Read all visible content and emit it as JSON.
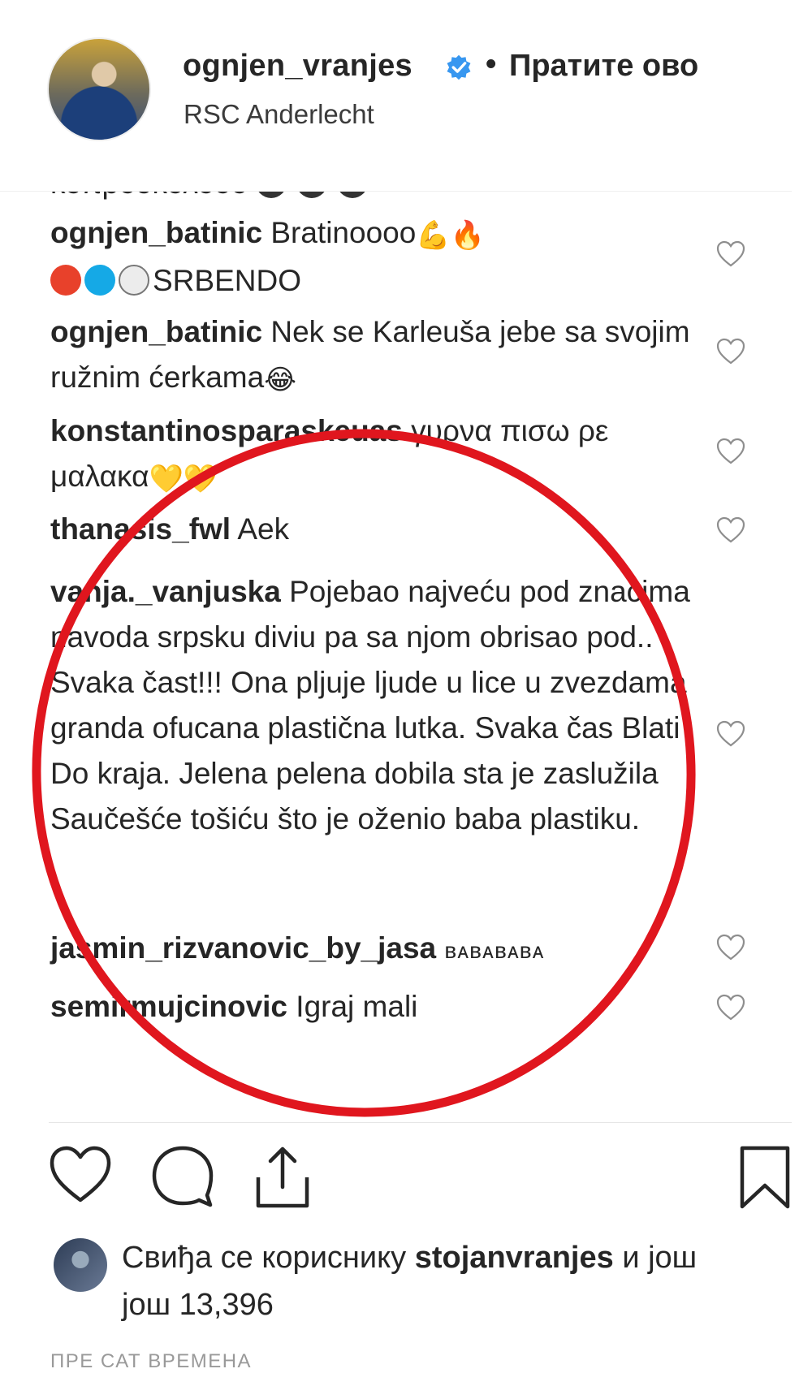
{
  "header": {
    "username": "ognjen_vranjes",
    "separator": "•",
    "follow_label": "Пратите ово",
    "location": "RSC Anderlecht"
  },
  "comments": {
    "cut_off_text": "κοπρουκολοοο",
    "items": [
      {
        "user": "ognjen_batinic",
        "text": "Bratinoooo",
        "line2_text": "SRBENDO"
      },
      {
        "user": "ognjen_batinic",
        "text": "Nek se Karleuša jebe sa svojim ružnim ćerkama"
      },
      {
        "user": "konstantinosparaskeuas",
        "text": "γυρνα πισω ρε μαλακα"
      },
      {
        "user": "thanasis_fwl",
        "text": "Aek"
      },
      {
        "user": "vanja._vanjuska",
        "text": "Pojebao najveću pod znacima navoda srpsku diviu pa sa njom obrisao pod.. Svaka čast!!! Ona pljuje ljude u lice u zvezdama granda ofucana plastična lutka. Svaka čas Blati Do kraja. Jelena pelena dobila sta je zaslužila Saučešće tošiću što je oženio baba plastiku."
      },
      {
        "user": "jasmin_rizvanovic_by_jasa",
        "text": "ʙᴀʙᴀʙᴀʙᴀ"
      },
      {
        "user": "semirmujcinovic",
        "text": "Igraj mali"
      }
    ]
  },
  "likes": {
    "prefix": "Свиђа се кориснику",
    "user": "stojanvranjes",
    "middle": "и још",
    "count_line": "још 13,396"
  },
  "timestamp": "ПРЕ САТ ВРЕМЕНА",
  "icons": {
    "verified": "verified-badge-icon",
    "like": "heart-icon",
    "comment": "comment-bubble-icon",
    "share": "share-icon",
    "save": "bookmark-icon"
  },
  "colors": {
    "verified_blue": "#3897f0",
    "annotation_red": "#e0161e",
    "text": "#262626",
    "muted": "#999999"
  }
}
